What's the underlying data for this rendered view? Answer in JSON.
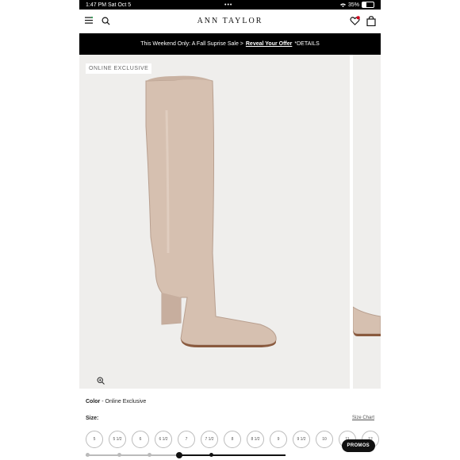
{
  "status_bar": {
    "time": "1:47 PM",
    "date": "Sat Oct 5",
    "dots": "•••",
    "battery": "35%",
    "battery_level": 0.35
  },
  "header": {
    "brand": "ANN TAYLOR"
  },
  "promo_banner": {
    "text": "This Weekend Only: A Fall Suprise Sale >",
    "link": "Reveal Your Offer",
    "details": "*DETAILS"
  },
  "product": {
    "badge": "ONLINE EXCLUSIVE",
    "color_label": "Color",
    "color_sep": "-",
    "color_value": "Online Exclusive",
    "size_label": "Size:",
    "size_chart": "Size Chart",
    "sizes": [
      "5",
      "5 1/2",
      "6",
      "6 1/2",
      "7",
      "7 1/2",
      "8",
      "8 1/2",
      "9",
      "9 1/2",
      "10",
      "11",
      "12"
    ]
  },
  "promos_button": "PROMOS",
  "colors": {
    "boot": "#d6c0b0",
    "boot_shadow": "#b89f8f",
    "sole": "#8a5a3e",
    "image_bg": "#efeeec"
  },
  "icons": [
    "menu-icon",
    "search-icon",
    "wishlist-heart-icon",
    "bag-icon",
    "zoom-icon"
  ]
}
